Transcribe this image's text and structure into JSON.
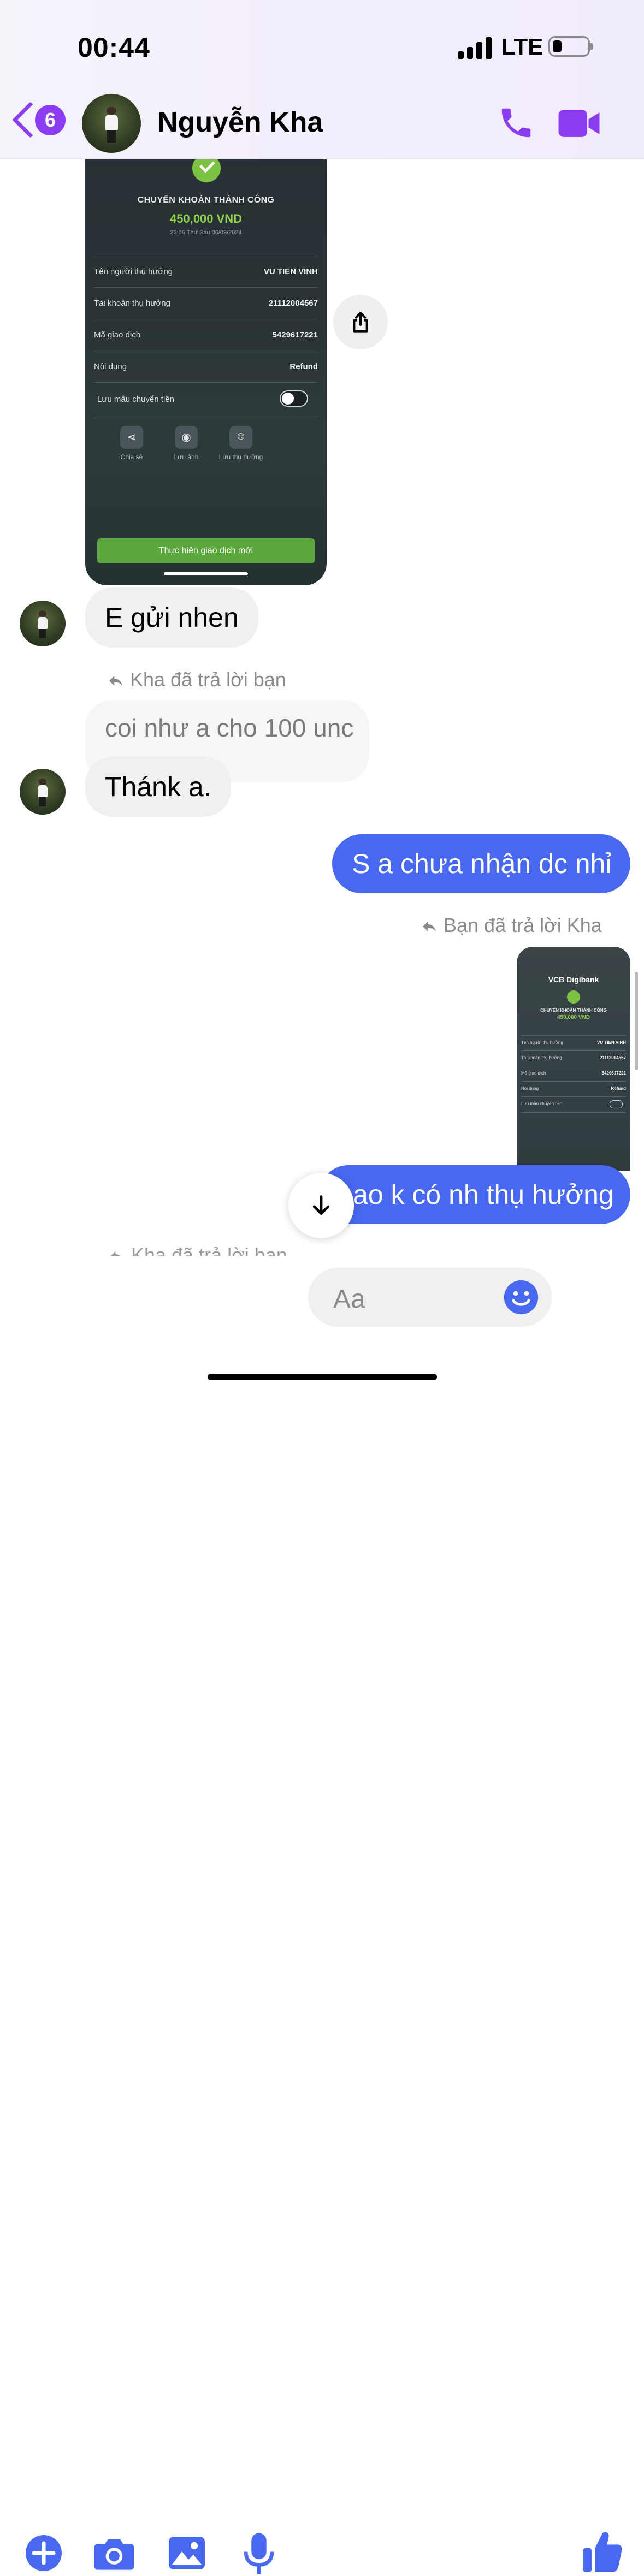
{
  "status_bar": {
    "time": "00:44",
    "network": "LTE"
  },
  "header": {
    "back_badge": "6",
    "contact_name": "Nguyễn Kha"
  },
  "received_screenshot": {
    "title": "CHUYỂN KHOẢN THÀNH CÔNG",
    "amount": "450,000 VND",
    "datetime": "23:06 Thứ Sáu 06/09/2024",
    "rows": [
      {
        "label": "Tên người thụ hưởng",
        "value": "VU TIEN VINH"
      },
      {
        "label": "Tài khoản thụ hưởng",
        "value": "21112004567"
      },
      {
        "label": "Mã giao dịch",
        "value": "5429617221"
      },
      {
        "label": "Nội dung",
        "value": "Refund"
      }
    ],
    "toggle_label": "Lưu mẫu chuyển tiền",
    "actions": [
      "Chia sẻ",
      "Lưu ảnh",
      "Lưu thụ hưởng"
    ],
    "button": "Thực hiện giao dịch mới"
  },
  "messages": {
    "m1": "E gửi nhen",
    "reply_tag_1": "Kha đã trả lời bạn",
    "quoted_1": "coi như a cho 100 unc",
    "m2": "Thánk a.",
    "m3": "S a chưa nhận dc nhỉ",
    "reply_tag_2": "Bạn đã trả lời Kha",
    "m4": "ao k có nh thụ hưởng",
    "peek_tag": "Kha đã trả lời bạn"
  },
  "sent_screenshot": {
    "bank": "VCB Digibank",
    "title": "CHUYỂN KHOẢN THÀNH CÔNG",
    "amount": "450,000 VND",
    "rows": [
      {
        "label": "Tên người thụ hưởng",
        "value": "VU TIEN VINH"
      },
      {
        "label": "Tài khoản thụ hưởng",
        "value": "21112004567"
      },
      {
        "label": "Mã giao dịch",
        "value": "5429617221"
      },
      {
        "label": "Nội dung",
        "value": "Refund"
      }
    ],
    "toggle_label": "Lưu mẫu chuyển tiền"
  },
  "composer": {
    "placeholder": "Aa"
  },
  "colors": {
    "accent_purple": "#8b3cf0",
    "messenger_blue": "#4968f0",
    "bubble_gray": "#f0f0f0"
  }
}
